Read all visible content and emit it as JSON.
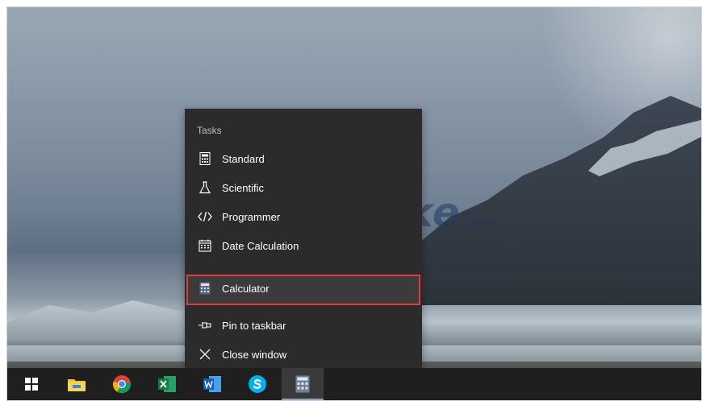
{
  "jump_list": {
    "section_title": "Tasks",
    "tasks": [
      {
        "label": "Standard",
        "icon": "standard-calculator-icon"
      },
      {
        "label": "Scientific",
        "icon": "flask-icon"
      },
      {
        "label": "Programmer",
        "icon": "code-icon"
      },
      {
        "label": "Date Calculation",
        "icon": "calendar-icon"
      }
    ],
    "app_label": "Calculator",
    "pin_label": "Pin to taskbar",
    "close_label": "Close window"
  },
  "watermark": {
    "text": "TipsMake",
    "suffix": ".com"
  },
  "taskbar": {
    "items": [
      "windows-start-icon",
      "file-explorer-icon",
      "chrome-icon",
      "excel-icon",
      "word-icon",
      "skype-icon",
      "calculator-icon"
    ],
    "active_item": "calculator-icon"
  },
  "colors": {
    "menu_bg": "#2b2b2b",
    "highlight_border": "#e23b3b",
    "taskbar_bg": "#1f1f1f"
  }
}
